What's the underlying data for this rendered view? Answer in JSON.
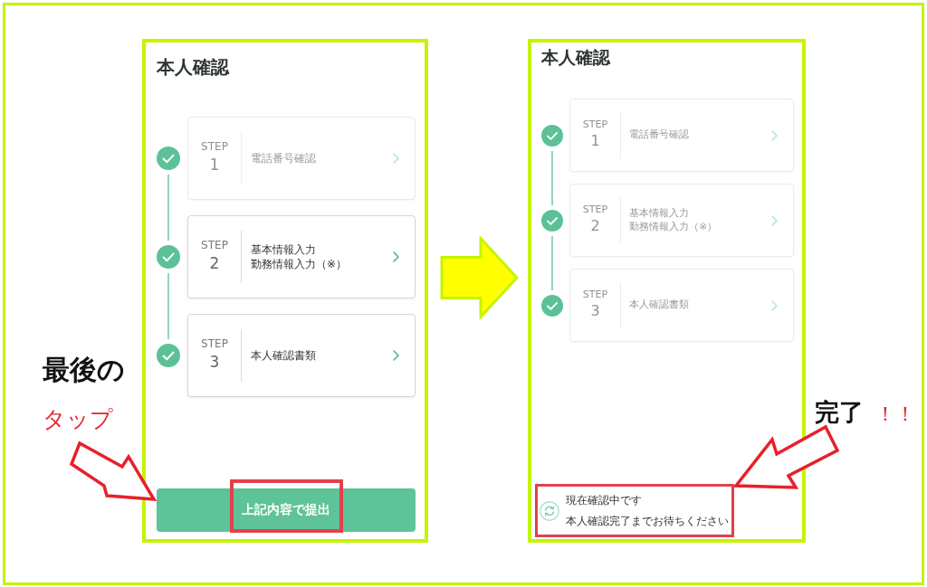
{
  "screens": [
    {
      "title": "本人確認",
      "steps": [
        {
          "label": "STEP",
          "number": "1",
          "lines": [
            "電話番号確認"
          ],
          "completed": true,
          "disabled": true
        },
        {
          "label": "STEP",
          "number": "2",
          "lines": [
            "基本情報入力",
            "勤務情報入力（※）"
          ],
          "completed": true,
          "disabled": false
        },
        {
          "label": "STEP",
          "number": "3",
          "lines": [
            "本人確認書類"
          ],
          "completed": true,
          "disabled": false
        }
      ],
      "footer": {
        "kind": "button",
        "label": "上記内容で提出",
        "highlighted": true
      }
    },
    {
      "title": "本人確認",
      "steps": [
        {
          "label": "STEP",
          "number": "1",
          "lines": [
            "電話番号確認"
          ],
          "completed": true,
          "disabled": true
        },
        {
          "label": "STEP",
          "number": "2",
          "lines": [
            "基本情報入力",
            "勤務情報入力（※）"
          ],
          "completed": true,
          "disabled": true
        },
        {
          "label": "STEP",
          "number": "3",
          "lines": [
            "本人確認書類"
          ],
          "completed": true,
          "disabled": true
        }
      ],
      "footer": {
        "kind": "status",
        "title": "現在確認中です",
        "message": "本人確認完了までお待ちください",
        "highlighted": true
      }
    }
  ],
  "annotations": [
    {
      "kind": "southeast",
      "lines": [
        [
          {
            "text": "最後の",
            "emphasis": false
          }
        ],
        [
          {
            "text": "タップ",
            "emphasis": true
          }
        ]
      ]
    },
    {
      "kind": "southwest",
      "lines": [
        [
          {
            "text": "完了",
            "emphasis": false
          },
          {
            "text": "！！",
            "emphasis": true
          }
        ]
      ]
    }
  ]
}
